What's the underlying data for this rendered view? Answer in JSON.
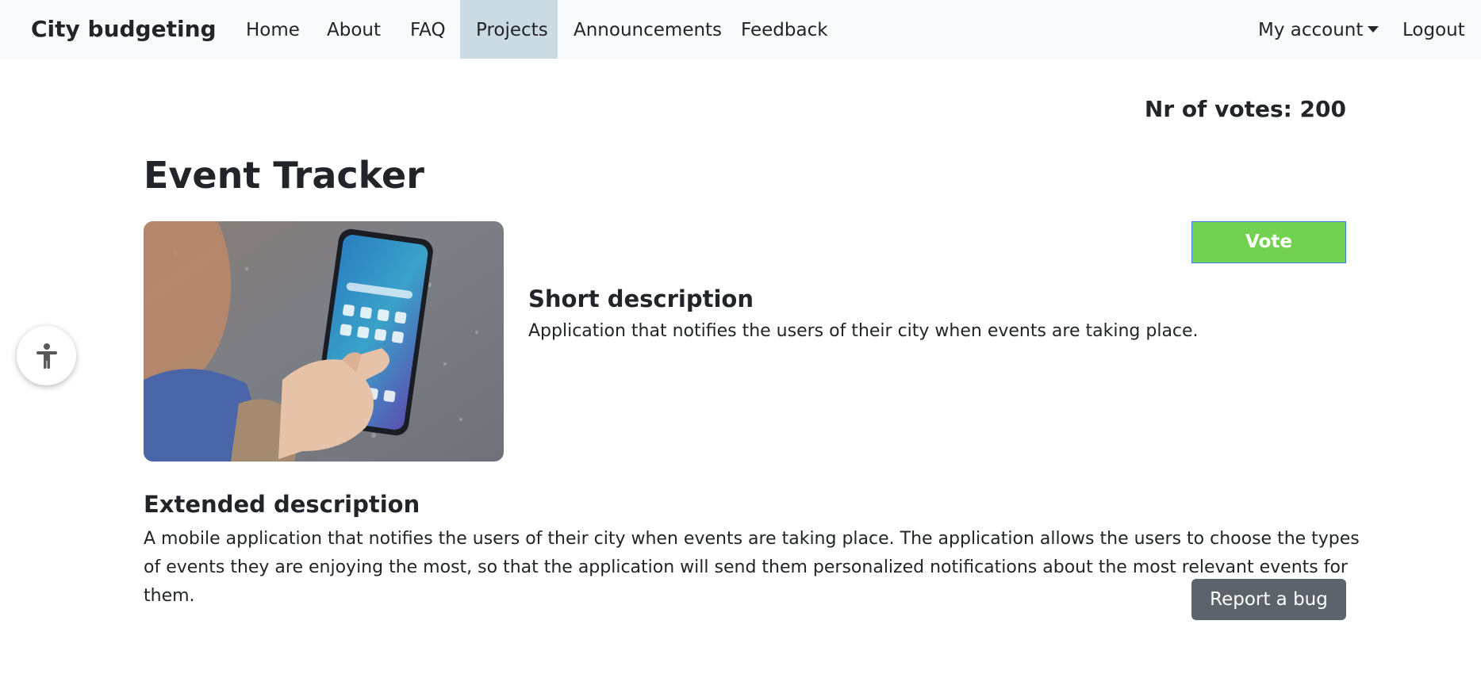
{
  "navbar": {
    "brand": "City budgeting",
    "items": [
      {
        "label": "Home"
      },
      {
        "label": "About"
      },
      {
        "label": "FAQ"
      },
      {
        "label": "Projects",
        "active": true
      },
      {
        "label": "Announcements"
      },
      {
        "label": "Feedback"
      }
    ],
    "account_label": "My account",
    "logout_label": "Logout"
  },
  "project": {
    "votes_text": "Nr of votes: 200",
    "title": "Event Tracker",
    "vote_label": "Vote",
    "short_heading": "Short description",
    "short_text": "Application that notifies the users of their city when events are taking place.",
    "extended_heading": "Extended description",
    "extended_text": "A mobile application that notifies the users of their city when events are taking place. The application allows the users to choose the types of events they are enjoying the most, so that the application will send them personalized notifications about the most relevant events for them.",
    "report_label": "Report a bug"
  },
  "icons": {
    "accessibility": "accessibility-icon",
    "caret": "caret-down-icon"
  },
  "colors": {
    "navbar_bg": "#f8f9fa",
    "active_tab": "#cadbe4",
    "vote_button": "#72d150",
    "report_button": "#5c636a"
  }
}
